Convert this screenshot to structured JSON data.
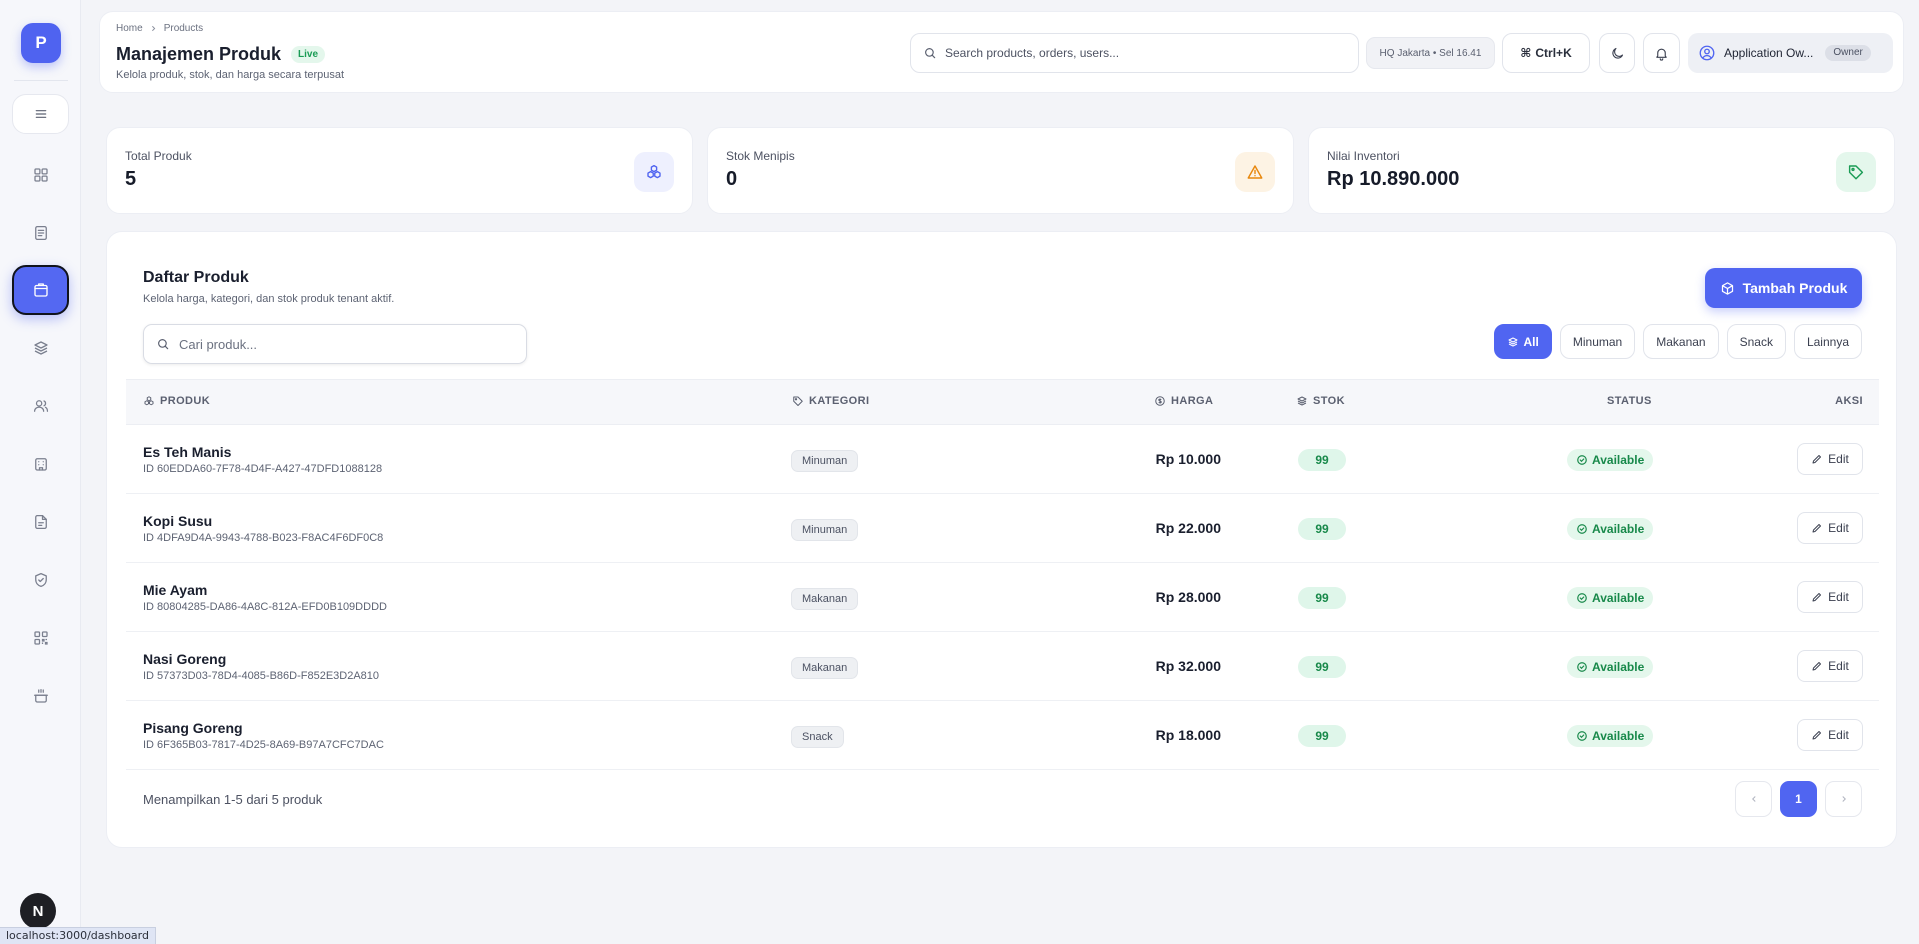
{
  "sidebar": {
    "logo_letter": "P",
    "items": [
      {
        "icon": "dashboard-icon",
        "active": false
      },
      {
        "icon": "orders-icon",
        "active": false
      },
      {
        "icon": "products-icon",
        "active": true
      },
      {
        "icon": "layers-icon",
        "active": false
      },
      {
        "icon": "users-icon",
        "active": false
      },
      {
        "icon": "building-icon",
        "active": false
      },
      {
        "icon": "document-icon",
        "active": false
      },
      {
        "icon": "shield-icon",
        "active": false
      },
      {
        "icon": "qr-icon",
        "active": false
      },
      {
        "icon": "kitchen-icon",
        "active": false
      }
    ],
    "avatar_letter": "N"
  },
  "status_url": "localhost:3000/dashboard",
  "header": {
    "breadcrumb": [
      "Home",
      "Products"
    ],
    "title": "Manajemen Produk",
    "live_badge": "Live",
    "subtitle": "Kelola produk, stok, dan harga secara terpusat",
    "search_placeholder": "Search products, orders, users...",
    "location": "HQ Jakarta • Sel 16.41",
    "shortcut": "Ctrl+K",
    "user_name": "Application Ow...",
    "user_role": "Owner"
  },
  "stats": [
    {
      "label": "Total Produk",
      "value": "5",
      "icon": "cubes-icon",
      "color": "#4f63f0",
      "bg": "#eef0fe"
    },
    {
      "label": "Stok Menipis",
      "value": "0",
      "icon": "warning-icon",
      "color": "#e8870d",
      "bg": "#fdf3e4"
    },
    {
      "label": "Nilai Inventori",
      "value": "Rp 10.890.000",
      "icon": "tag-icon",
      "color": "#1a9c55",
      "bg": "#e4f7ec"
    }
  ],
  "panel": {
    "title": "Daftar Produk",
    "subtitle": "Kelola harga, kategori, dan stok produk tenant aktif.",
    "add_button": "Tambah Produk",
    "search_placeholder": "Cari produk...",
    "filters": [
      {
        "label": "All",
        "active": true
      },
      {
        "label": "Minuman",
        "active": false
      },
      {
        "label": "Makanan",
        "active": false
      },
      {
        "label": "Snack",
        "active": false
      },
      {
        "label": "Lainnya",
        "active": false
      }
    ],
    "columns": {
      "product": "PRODUK",
      "category": "KATEGORI",
      "price": "HARGA",
      "stock": "STOK",
      "status": "STATUS",
      "action": "AKSI"
    },
    "rows": [
      {
        "name": "Es Teh Manis",
        "id": "ID 60EDDA60-7F78-4D4F-A427-47DFD1088128",
        "category": "Minuman",
        "price": "Rp 10.000",
        "stock": "99",
        "status": "Available",
        "action": "Edit"
      },
      {
        "name": "Kopi Susu",
        "id": "ID 4DFA9D4A-9943-4788-B023-F8AC4F6DF0C8",
        "category": "Minuman",
        "price": "Rp 22.000",
        "stock": "99",
        "status": "Available",
        "action": "Edit"
      },
      {
        "name": "Mie Ayam",
        "id": "ID 80804285-DA86-4A8C-812A-EFD0B109DDDD",
        "category": "Makanan",
        "price": "Rp 28.000",
        "stock": "99",
        "status": "Available",
        "action": "Edit"
      },
      {
        "name": "Nasi Goreng",
        "id": "ID 57373D03-78D4-4085-B86D-F852E3D2A810",
        "category": "Makanan",
        "price": "Rp 32.000",
        "stock": "99",
        "status": "Available",
        "action": "Edit"
      },
      {
        "name": "Pisang Goreng",
        "id": "ID 6F365B03-7817-4D25-8A69-B97A7CFC7DAC",
        "category": "Snack",
        "price": "Rp 18.000",
        "stock": "99",
        "status": "Available",
        "action": "Edit"
      }
    ],
    "footer_text": "Menampilkan 1-5 dari 5 produk",
    "current_page": "1"
  }
}
